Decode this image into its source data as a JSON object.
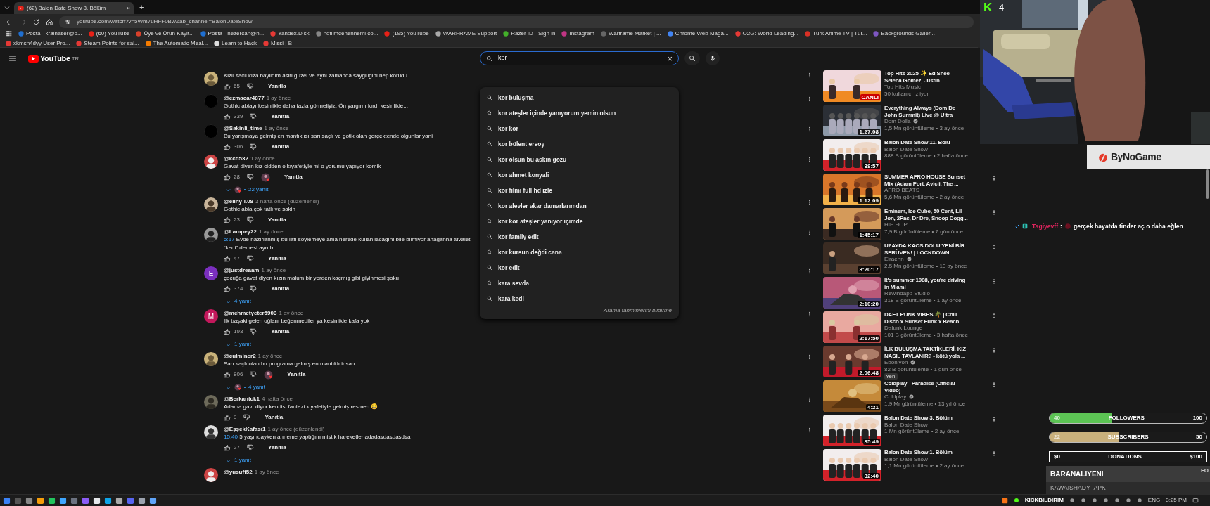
{
  "browser": {
    "tabs": [
      {
        "title": "(62) Balon Date Show 8. Bölüm",
        "selected": true,
        "close": "×"
      }
    ],
    "new_tab": "+",
    "url": "youtube.com/watch?v=5Wm7uHFF0Bw&ab_channel=BalonDateShow",
    "bookmarks": [
      "Posta - kralnaser@o...",
      "(60) YouTube",
      "Üye ve Ürün Kayit...",
      "Posta - nezercan@h...",
      "Yandex.Disk",
      "hdfilmcehennemi.co...",
      "(195) YouTube",
      "WARFRAME Support",
      "Razer ID - Sign in",
      "Instagram",
      "Warframe Market | ...",
      "Chrome Web Mağa...",
      "O2G: World Leading...",
      "Türk Anime TV | Tür...",
      "Backgrounds Galler...",
      "xkmsh4dyy User Pro...",
      "Steam Points for sal...",
      "The Automatic Meal...",
      "Learn to Hack",
      "Missi | B"
    ]
  },
  "header": {
    "logo": "YouTube",
    "region": "TR",
    "search": {
      "value": "kor",
      "clear": "×"
    }
  },
  "suggestions": {
    "items": [
      "kör buluşma",
      "kor ateşler içinde yanıyorum yemin olsun",
      "kor kor",
      "kor bülent ersoy",
      "kor olsun bu askin gozu",
      "kor ahmet konyali",
      "kor filmi full hd izle",
      "kor alevler akar damarlarımdan",
      "kor kor ateşler yanıyor içimde",
      "kor family edit",
      "kor kursun değdi cana",
      "kor edit",
      "kara sevda",
      "kara kedi"
    ],
    "footer": "Arama tahminlerini bildirme"
  },
  "comments": [
    {
      "text": "Kizil sacli kiza bayildim asiri guzel ve ayni zamanda saygiligini hep korudu",
      "likes": "65",
      "reply": "Yanıtla",
      "heart": false
    },
    {
      "avatar": {
        "kind": "blank"
      },
      "user": "@ezmacar4877",
      "time": "1 ay önce",
      "text": "Gothic ablayı kesinlikle daha fazla görmeliyiz. Ön yargımı kırdı kesinlikle...",
      "likes": "339",
      "reply": "Yanıtla",
      "heart": false
    },
    {
      "avatar": {
        "kind": "blank"
      },
      "user": "@Sakinli_time",
      "time": "1 ay önce",
      "text": "Bu yarışmaya gelmiş en mantıklısı sarı saçlı ve gotik olan gerçektende olgunlar yani",
      "likes": "306",
      "reply": "Yanıtla",
      "heart": false
    },
    {
      "user": "@kcd532",
      "time": "1 ay önce",
      "text": "Gavat diyen kız cidden o kıyafetiyle mi o yorumu yapıyor komik",
      "likes": "28",
      "reply": "Yanıtla",
      "heart": true,
      "replies": {
        "label": "22 yanıt",
        "avatar": true
      }
    },
    {
      "user": "@eliny-l.08",
      "time": "3 hafta önce (düzenlendi)",
      "text": "Gothic abla çok tatlı ve sakin",
      "likes": "23",
      "reply": "Yanıtla",
      "heart": false
    },
    {
      "user": "@Lampey22",
      "time": "1 ay önce",
      "timestamp": "5:17",
      "text": "Evde hazırlanmış bu lafı söylemeye ama nerede kullanılacağını bile bilmiyor ahagahha tuvalet “kedi” demesi ayrı b",
      "likes": "47",
      "reply": "Yanıtla",
      "heart": false
    },
    {
      "avatar": {
        "kind": "letter",
        "letter": "E",
        "color": "#7b2fbf"
      },
      "user": "@justdreaam",
      "time": "1 ay önce",
      "text": "çocuğa gavat diyen kızın malum bir yerden kaçmış gibi giyinmesi şoku",
      "likes": "374",
      "reply": "Yanıtla",
      "heart": false,
      "replies": {
        "label": "4 yanıt",
        "avatar": false
      }
    },
    {
      "avatar": {
        "kind": "letter",
        "letter": "M",
        "color": "#c2185b"
      },
      "user": "@mehmetyeter5903",
      "time": "1 ay önce",
      "text": "İlk başaki gelen oğlanı beğenmediler ya kesinlikle kafa yok",
      "likes": "193",
      "reply": "Yanıtla",
      "heart": false,
      "replies": {
        "label": "1 yanıt",
        "avatar": false
      }
    },
    {
      "user": "@culminer2",
      "time": "1 ay önce",
      "text": "Sarı saçlı olan bu programa gelmiş en mantıklı insan",
      "likes": "806",
      "reply": "Yanıtla",
      "heart": true,
      "replies": {
        "label": "4 yanıt",
        "avatar": true
      }
    },
    {
      "user": "@Berkantck1",
      "time": "4 hafta önce",
      "text": "Adama gavt diyor kendisi fantezi kıyafetiyle gelmiş resmen 😆",
      "likes": "9",
      "reply": "Yanıtla",
      "heart": false
    },
    {
      "user": "@EşşekKafası1",
      "time": "1 ay önce (düzenlendi)",
      "timestamp": "15:40",
      "text": "5 yaşındayken anneme yaptığım mistik hareketler adadasdasdasdsa",
      "likes": "27",
      "reply": "Yanıtla",
      "heart": false,
      "replies": {
        "label": "1 yanıt",
        "avatar": false
      }
    },
    {
      "user": "@yusuff52",
      "time": "1 ay önce"
    }
  ],
  "sidebar": [
    {
      "title_lines": [
        "Top Hits 2025 ✨ Ed Shee",
        "Selena Gomez, Justin ..."
      ],
      "channel": "Top Hits Music",
      "verified": false,
      "meta": "50 kullanıcı izliyor",
      "badge": {
        "kind": "live",
        "text": "CANLI"
      },
      "menu": false
    },
    {
      "title_lines": [
        "Everything Always (Dom De",
        "John Summit) Live @ Ultra"
      ],
      "channel": "Dom Dolla",
      "verified": true,
      "meta": "1,5 Mn görüntüleme • 3 ay önce",
      "badge": {
        "kind": "duration",
        "text": "1:27:08"
      },
      "menu": false
    },
    {
      "title_lines": [
        "Balon Date Show 11. Bölü"
      ],
      "channel": "Balon Date Show",
      "verified": false,
      "meta": "888 B görüntüleme • 2 hafta önce",
      "badge": {
        "kind": "duration",
        "text": "38:57"
      },
      "menu": false
    },
    {
      "title_lines": [
        "SUMMER AFRO HOUSE Sunset",
        "Mix (Adam Port, Avicii, The ..."
      ],
      "channel": "AFRO BEATS",
      "verified": false,
      "meta": "5,6 Mn görüntüleme • 2 ay önce",
      "badge": {
        "kind": "duration",
        "text": "1:12:09"
      },
      "menu": true
    },
    {
      "title_lines": [
        "Eminem, Ice Cube, 50 Cent, Lil",
        "Jon, 2Pac, Dr Dre, Snoop Dogg..."
      ],
      "channel": "HIP HOP",
      "verified": false,
      "meta": "7,9 B görüntüleme • 7 gün önce",
      "badge": {
        "kind": "duration",
        "text": "1:45:17"
      },
      "menu": true
    },
    {
      "title_lines": [
        "UZAYDA KAOS DOLU YENİ BİR",
        "SERÜVEN! | LOCKDOWN ..."
      ],
      "channel": "Elraenn",
      "verified": true,
      "meta": "2,5 Mn görüntüleme • 10 ay önce",
      "badge": {
        "kind": "duration",
        "text": "3:20:17"
      },
      "menu": true
    },
    {
      "title_lines": [
        "It's summer 1988, you're driving",
        "in Miami"
      ],
      "channel": "Rewindapp Studio",
      "verified": false,
      "meta": "318 B görüntüleme • 1 ay önce",
      "badge": {
        "kind": "duration",
        "text": "2:10:20"
      },
      "menu": true
    },
    {
      "title_lines": [
        "DAFT PUNK VIBES 🌴 | Chill",
        "Disco x Sunset Funk x Beach ..."
      ],
      "channel": "Dafunk Lounge",
      "verified": false,
      "meta": "101 B görüntüleme • 3 hafta önce",
      "badge": {
        "kind": "duration",
        "text": "2:17:50"
      },
      "menu": true
    },
    {
      "title_lines": [
        "İLK BULUŞMA TAKTİKLERİ, KIZ",
        "NASIL TAVLANIR? - kötü yola ..."
      ],
      "channel": "Ebonivon",
      "verified": true,
      "meta": "82 B görüntüleme • 1 gün önce",
      "tag": "Yeni",
      "badge": {
        "kind": "duration",
        "text": "2:06:48"
      },
      "menu": true
    },
    {
      "title_lines": [
        "Coldplay - Paradise (Official",
        "Video)"
      ],
      "channel": "Coldplay",
      "verified": true,
      "meta": "1,9 Mr görüntüleme • 13 yıl önce",
      "badge": {
        "kind": "duration",
        "text": "4:21"
      },
      "menu": true
    },
    {
      "title_lines": [
        "Balon Date Show 3. Bölüm"
      ],
      "channel": "Balon Date Show",
      "verified": false,
      "meta": "1 Mn görüntüleme • 2 ay önce",
      "badge": {
        "kind": "duration",
        "text": "35:49"
      },
      "menu": true
    },
    {
      "title_lines": [
        "Balon Date Show 1. Bölüm"
      ],
      "channel": "Balon Date Show",
      "verified": false,
      "meta": "1,1 Mn görüntüleme • 2 ay önce",
      "badge": {
        "kind": "duration",
        "text": "32:40"
      },
      "menu": true
    }
  ],
  "overlay": {
    "logo": "K",
    "viewers": "4",
    "sponsor": "ByNoGame",
    "chat": [
      {
        "user": "Tagiyevff",
        "color": "#e0245e",
        "separator": ":",
        "text": "gerçek hayatda tinder aç o daha eğlen"
      }
    ],
    "goals": [
      {
        "start": "40",
        "label": "FOLLOWERS",
        "end": "100",
        "level": 0.4,
        "color": "#5cc454",
        "kind": "pill"
      },
      {
        "start": "22",
        "label": "SUBSCRIBERS",
        "end": "50",
        "level": 0.44,
        "color": "#c9b07c",
        "kind": "pill"
      },
      {
        "start": "$0",
        "label": "DONATIONS",
        "end": "$100",
        "level": 0,
        "color": "#ffffff",
        "kind": "box"
      }
    ],
    "events": [
      {
        "name": "BARANALIYENI",
        "tag": "FO"
      },
      {
        "name": "KAWAISHADY_APK"
      }
    ]
  },
  "taskbar": {
    "tray_label": "KICKBILDIRIM",
    "language": "ENG",
    "time": "3:25 PM"
  }
}
